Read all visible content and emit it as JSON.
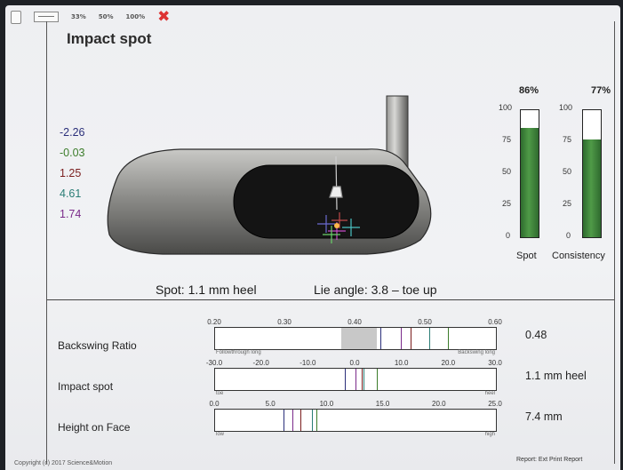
{
  "toolbar": {
    "zoom_options": [
      "33%",
      "50%",
      "100%"
    ]
  },
  "panel": {
    "title": "Impact spot"
  },
  "impact_values": [
    {
      "value": "-2.26",
      "color": "#2b2f7a"
    },
    {
      "value": "-0.03",
      "color": "#3c7d2a"
    },
    {
      "value": "1.25",
      "color": "#7a1e1e"
    },
    {
      "value": "4.61",
      "color": "#2a7d76"
    },
    {
      "value": "1.74",
      "color": "#7a2a8a"
    }
  ],
  "gauges": [
    {
      "name": "Spot",
      "percent_label": "86%",
      "level": 0.86
    },
    {
      "name": "Consistency",
      "percent_label": "77%",
      "level": 0.77
    }
  ],
  "gauge_scale": [
    "100",
    "75",
    "50",
    "25",
    "0"
  ],
  "summary": {
    "spot": "Spot: 1.1 mm heel",
    "lie": "Lie angle: 3.8 – toe up"
  },
  "rows": [
    {
      "label": "Backswing Ratio",
      "ticks": [
        "0.20",
        "0.30",
        "0.40",
        "0.50",
        "0.60"
      ],
      "left_end": "Followthrough long",
      "right_end": "Backswing long",
      "value": "0.48",
      "shade": [
        0.38,
        0.43
      ],
      "marks": [
        0.436,
        0.465,
        0.478,
        0.505,
        0.532
      ],
      "min": 0.2,
      "max": 0.6
    },
    {
      "label": "Impact spot",
      "ticks": [
        "-30.0",
        "-20.0",
        "-10.0",
        "0.0",
        "10.0",
        "20.0",
        "30.0"
      ],
      "left_end": "toe",
      "right_end": "heel",
      "value": "1.1 mm heel",
      "marks": [
        -2.26,
        -0.03,
        1.25,
        1.74,
        4.61
      ],
      "min": -30,
      "max": 30
    },
    {
      "label": "Height on Face",
      "ticks": [
        "0.0",
        "5.0",
        "10.0",
        "15.0",
        "20.0",
        "25.0"
      ],
      "left_end": "low",
      "right_end": "high",
      "value": "7.4 mm",
      "marks": [
        6.1,
        6.9,
        7.6,
        8.6,
        9.0
      ],
      "min": 0,
      "max": 25
    }
  ],
  "mark_colors": [
    "#2b2f7a",
    "#7a2a8a",
    "#7a1e1e",
    "#2a7d76",
    "#3c7d2a"
  ],
  "footer": {
    "copyright": "Copyright (c) 2017 Science&Motion",
    "report": "Report: Ext Print Report"
  }
}
